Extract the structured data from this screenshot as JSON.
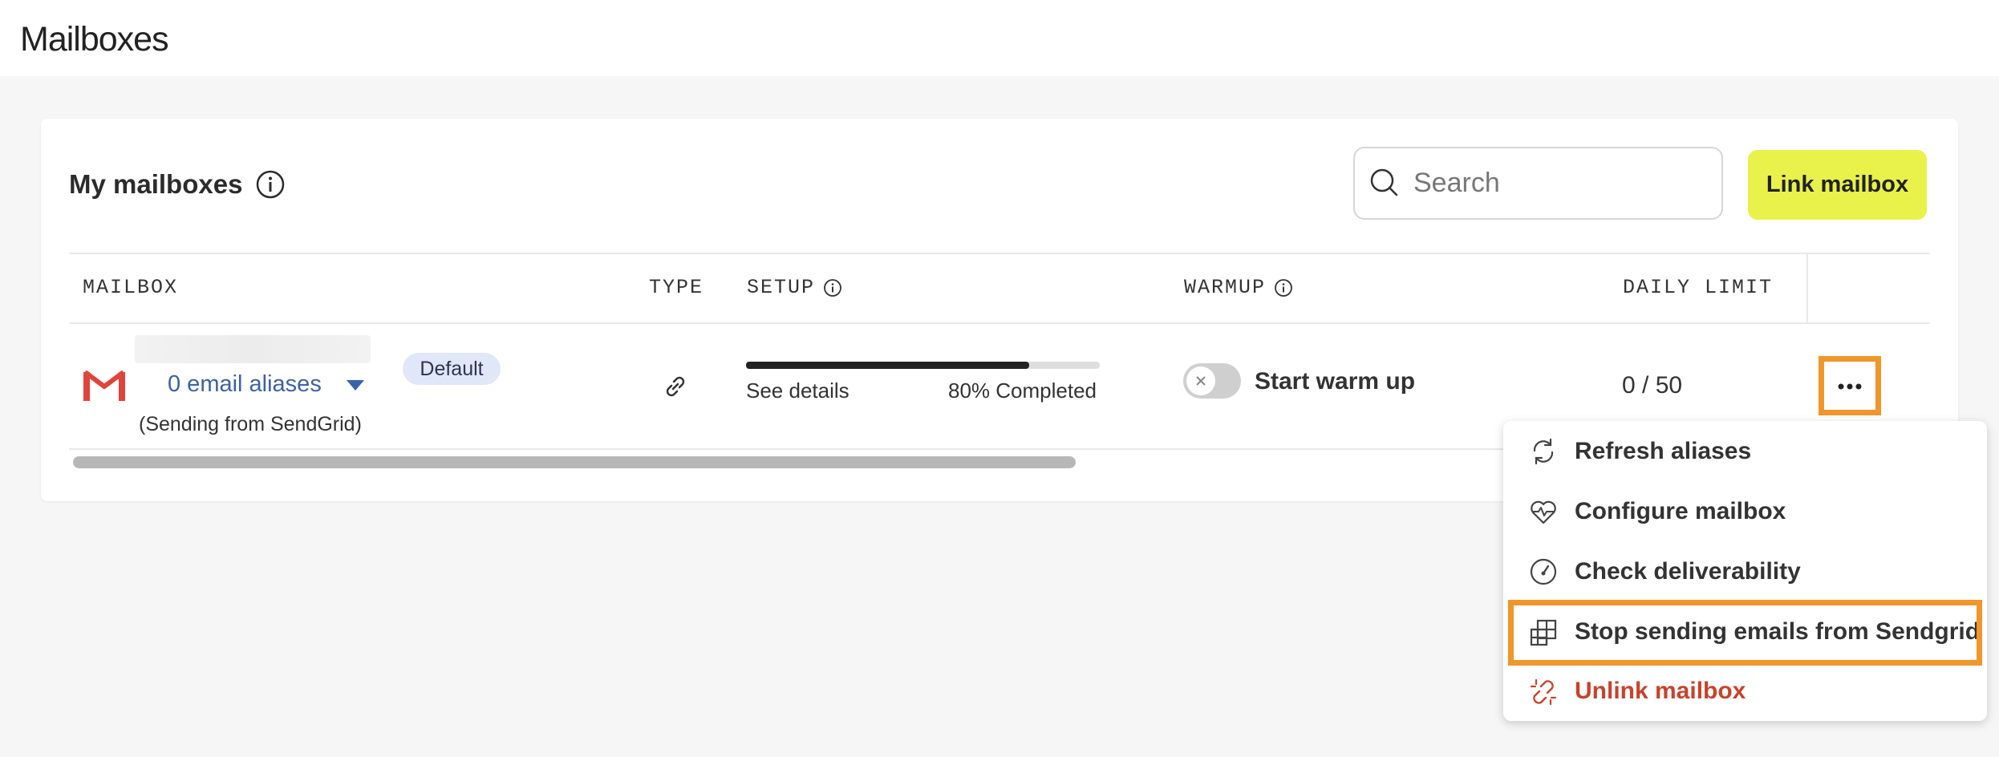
{
  "page": {
    "title": "Mailboxes"
  },
  "card": {
    "title": "My mailboxes",
    "search_placeholder": "Search",
    "link_button": "Link mailbox"
  },
  "table": {
    "columns": [
      "MAILBOX",
      "TYPE",
      "SETUP",
      "WARMUP",
      "DAILY LIMIT"
    ],
    "row": {
      "aliases": "0 email aliases",
      "badge": "Default",
      "sending": "(Sending from SendGrid)",
      "setup_link": "See details",
      "setup_progress_label": "80% Completed",
      "setup_progress": 0.8,
      "warmup_label": "Start warm up",
      "warmup_enabled": false,
      "daily_limit": "0 / 50"
    }
  },
  "menu": {
    "items": [
      {
        "label": "Refresh aliases",
        "icon": "refresh-icon"
      },
      {
        "label": "Configure mailbox",
        "icon": "heart-pulse-icon"
      },
      {
        "label": "Check deliverability",
        "icon": "gauge-icon"
      },
      {
        "label": "Stop sending emails from Sendgrid",
        "icon": "grid-icon"
      },
      {
        "label": "Unlink mailbox",
        "icon": "unlink-icon"
      }
    ]
  },
  "colors": {
    "accent_button": "#e8f24a",
    "highlight": "#f0962a",
    "link_blue": "#3b62a6",
    "danger": "#c8432b",
    "badge_bg": "#dfe7f8"
  }
}
